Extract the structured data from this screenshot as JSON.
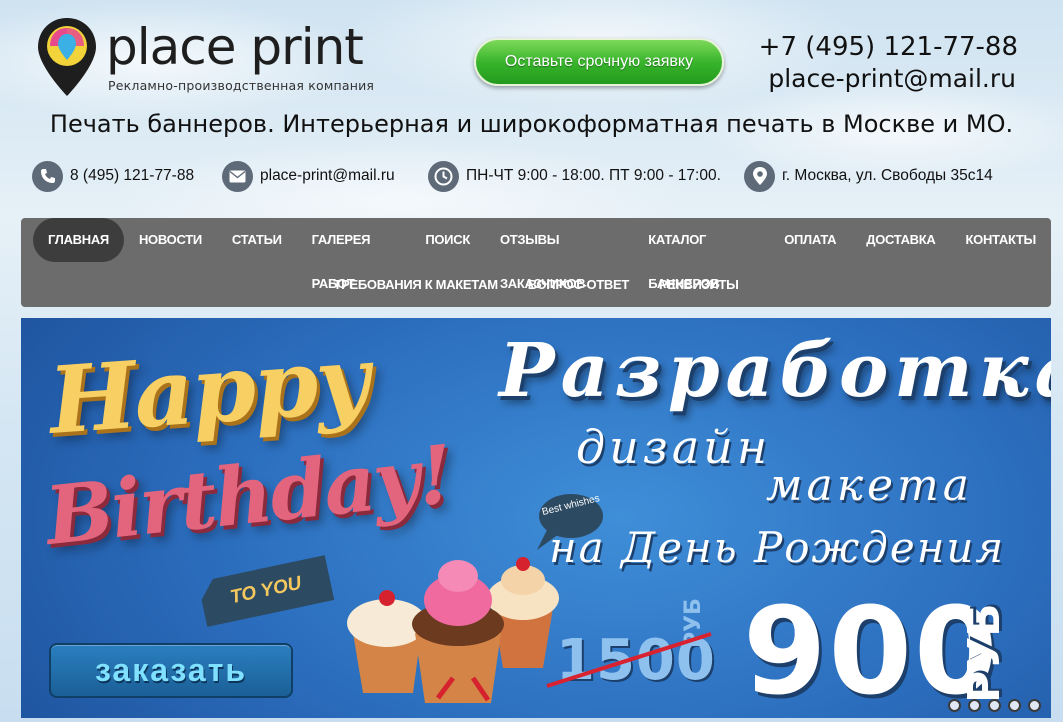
{
  "header": {
    "logo_name": "place print",
    "logo_tagline": "Рекламно-производственная компания",
    "cta_label": "Оставьте срочную заявку",
    "phone": "+7 (495) 121-77-88",
    "email": "place-print@mail.ru",
    "tagline": "Печать баннеров. Интерьерная и широкоформатная печать в Москве и МО."
  },
  "contacts": {
    "phone": "8 (495) 121-77-88",
    "email": "place-print@mail.ru",
    "hours": "ПН-ЧТ 9:00 - 18:00. ПТ 9:00 - 17:00.",
    "address": "г. Москва, ул. Свободы 35с14"
  },
  "nav": {
    "row1": [
      "ГЛАВНАЯ",
      "НОВОСТИ",
      "СТАТЬИ",
      "ГАЛЕРЕЯ РАБОТ",
      "ПОИСК",
      "ОТЗЫВЫ ЗАКАЗЧИКОВ",
      "КАТАЛОГ БАННЕРОВ",
      "ОПЛАТА",
      "ДОСТАВКА",
      "КОНТАКТЫ"
    ],
    "row2": [
      "ТРЕБОВАНИЯ К МАКЕТАМ",
      "ВОПРОС-ОТВЕТ",
      "РЕКВИЗИТЫ"
    ],
    "active": "ГЛАВНАЯ"
  },
  "banner": {
    "happy": "Happy",
    "birthday": "Birthday!",
    "to_you": "TO YOU",
    "bubble": "Best whishes",
    "order_button": "заказать",
    "title": "Разработка",
    "line2": "дизайн",
    "line3": "макета",
    "line4": "на День Рождения",
    "old_price": "1500",
    "old_currency": "РУБ",
    "new_price": "900",
    "new_currency": "РУБ",
    "slide_count": 5,
    "active_slide": 1
  },
  "icons": {
    "contact_icon_bg": "#5f6a78",
    "cta_green": "#39b52c",
    "nav_bg": "#6c6c6c",
    "nav_active_bg": "#3d3d3d",
    "banner_blue": "#2c6fbf"
  }
}
